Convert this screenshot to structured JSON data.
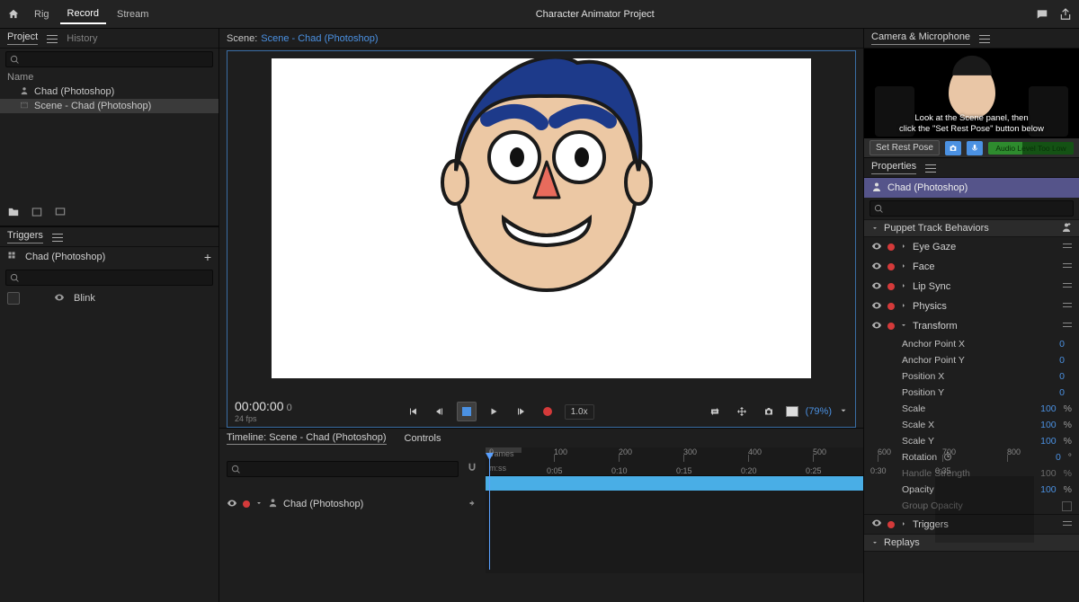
{
  "topbar": {
    "modes": [
      "Rig",
      "Record",
      "Stream"
    ],
    "active_mode_index": 1,
    "title": "Character Animator Project"
  },
  "project": {
    "tabs": [
      "Project",
      "History"
    ],
    "name_column": "Name",
    "items": [
      {
        "label": "Chad (Photoshop)",
        "type": "puppet"
      },
      {
        "label": "Scene - Chad (Photoshop)",
        "type": "scene",
        "selected": true
      }
    ]
  },
  "triggers": {
    "panel_title": "Triggers",
    "group_label": "Chad (Photoshop)",
    "items": [
      {
        "label": "Blink"
      }
    ]
  },
  "scene": {
    "prefix": "Scene:",
    "link_label": "Scene - Chad (Photoshop)",
    "timecode": "00:00:00",
    "frame": "0",
    "fps_label": "24 fps",
    "rate": "1.0x",
    "zoom_pct": "(79%)"
  },
  "camera": {
    "panel_title": "Camera & Microphone",
    "hint_line1": "Look at the Scene panel, then",
    "hint_line2": "click the \"Set Rest Pose\" button below",
    "rest_button": "Set Rest Pose",
    "audio_label": "Audio Level Too Low"
  },
  "properties": {
    "panel_title": "Properties",
    "puppet_name": "Chad (Photoshop)",
    "track_section": "Puppet Track Behaviors",
    "behaviors": [
      "Eye Gaze",
      "Face",
      "Lip Sync",
      "Physics"
    ],
    "transform_label": "Transform",
    "transform_rows": [
      {
        "name": "Anchor Point X",
        "value": "0",
        "unit": ""
      },
      {
        "name": "Anchor Point Y",
        "value": "0",
        "unit": ""
      },
      {
        "name": "Position X",
        "value": "0",
        "unit": ""
      },
      {
        "name": "Position Y",
        "value": "0",
        "unit": ""
      },
      {
        "name": "Scale",
        "value": "100",
        "unit": "%"
      },
      {
        "name": "Scale X",
        "value": "100",
        "unit": "%"
      },
      {
        "name": "Scale Y",
        "value": "100",
        "unit": "%"
      }
    ],
    "rotation": {
      "name": "Rotation",
      "value": "0",
      "unit": "°"
    },
    "handle_row": {
      "name": "Handle Strength",
      "value": "100",
      "unit": "%"
    },
    "opacity_row": {
      "name": "Opacity",
      "value": "100",
      "unit": "%"
    },
    "group_opacity": "Group Opacity",
    "triggers_section": "Triggers",
    "replays_section": "Replays"
  },
  "timeline": {
    "title": "Timeline: Scene - Chad (Photoshop)",
    "controls_tab": "Controls",
    "units_frames": "frames",
    "units_mss": "m:ss",
    "track_label": "Chad (Photoshop)",
    "frame_ticks": [
      "0",
      "100",
      "200",
      "300",
      "400",
      "500",
      "600",
      "700",
      "800"
    ],
    "time_ticks": [
      "0:05",
      "0:10",
      "0:15",
      "0:20",
      "0:25",
      "0:30",
      "0:35"
    ]
  }
}
